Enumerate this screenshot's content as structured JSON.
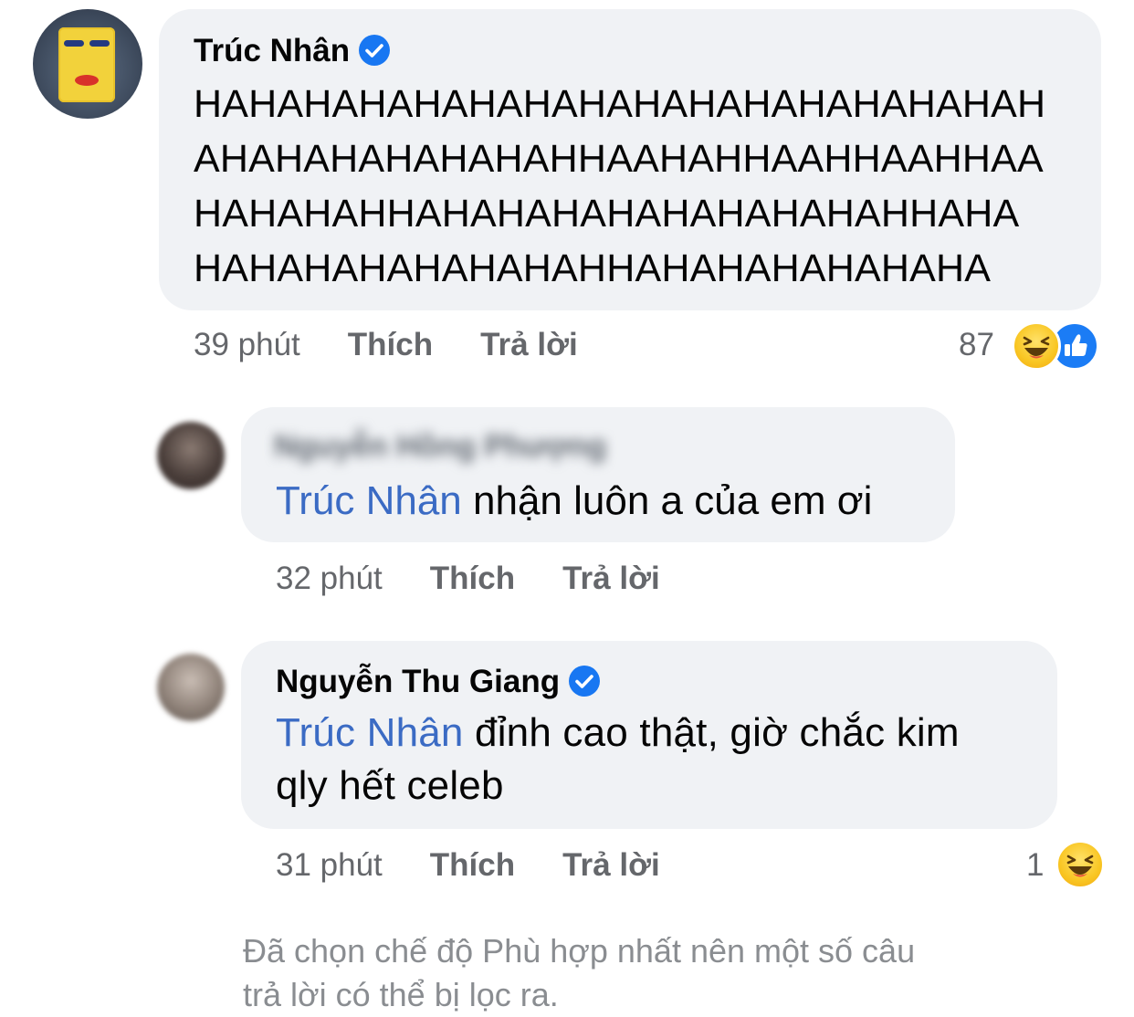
{
  "comments": [
    {
      "author": "Trúc Nhân",
      "verified": true,
      "text_lines": [
        "HAHAHAHAHAHAHAHAHAHAHAHAHAHAHAH",
        "AHAHAHAHAHAHAHHAAHAHHAAHHAAHHAA",
        "HAHAHAHHAHAHAHAHAHAHAHAHAHHAHA",
        "HAHAHAHAHAHAHAHHAHAHAHAHAHAHA"
      ],
      "time": "39 phút",
      "like_label": "Thích",
      "reply_label": "Trả lời",
      "reaction_count": "87",
      "reactions": [
        "haha-icon",
        "like-icon"
      ]
    },
    {
      "author": "Nguyễn Hồng Phượng",
      "author_blurred": true,
      "mention": "Trúc Nhân",
      "text": " nhận luôn a của em ơi",
      "time": "32 phút",
      "like_label": "Thích",
      "reply_label": "Trả lời"
    },
    {
      "author": "Nguyễn Thu Giang",
      "verified": true,
      "mention": "Trúc Nhân",
      "text_line1": " đỉnh cao thật, giờ chắc kim",
      "text_line2": "qly hết celeb",
      "time": "31 phút",
      "like_label": "Thích",
      "reply_label": "Trả lời",
      "reaction_count": "1",
      "reactions": [
        "haha-icon"
      ]
    }
  ],
  "filter_note": {
    "line1": "Đã chọn chế độ Phù hợp nhất nên một số câu",
    "line2": "trả lời có thể bị lọc ra."
  },
  "colors": {
    "bubble": "#f0f2f5",
    "mention": "#3b6bc4",
    "meta": "#65676b",
    "verified": "#1877f2",
    "note": "#8a8d91"
  }
}
